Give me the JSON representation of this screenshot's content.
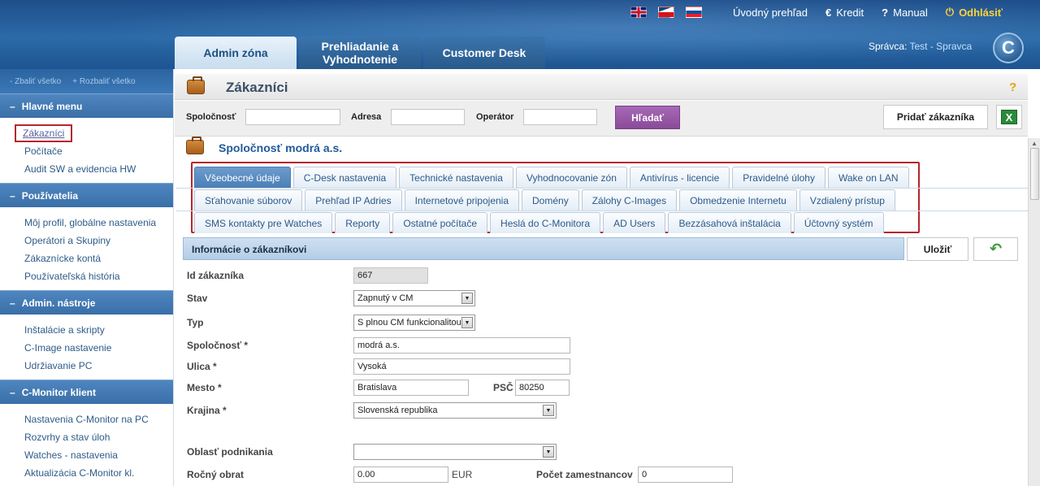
{
  "top_nav": {
    "links": [
      "Úvodný prehľad",
      "Kredit",
      "Manual",
      "Odhlásiť"
    ],
    "icons": [
      "€",
      "?",
      "⏻"
    ]
  },
  "main_tabs": [
    "Admin zóna",
    "Prehliadanie a Vyhodnotenie",
    "Customer Desk"
  ],
  "admin": {
    "label": "Správca:",
    "name": "Test - Spravca"
  },
  "sidebar": {
    "collapse_all": "- Zbaliť všetko",
    "expand_all": "+ Rozbaliť všetko",
    "sections": [
      {
        "title": "Hlavné menu",
        "items": [
          "Zákazníci",
          "Počítače",
          "Audit SW a evidencia HW"
        ]
      },
      {
        "title": "Používatelia",
        "items": [
          "Môj profil, globálne nastavenia",
          "Operátori a Skupiny",
          "Zákaznícke kontá",
          "Používateľská história"
        ]
      },
      {
        "title": "Admin. nástroje",
        "items": [
          "Inštalácie a skripty",
          "C-Image nastavenie",
          "Udržiavanie PC"
        ]
      },
      {
        "title": "C-Monitor klient",
        "items": [
          "Nastavenia C-Monitor na PC",
          "Rozvrhy a stav úloh",
          "Watches - nastavenia",
          "Aktualizácia C-Monitor kl."
        ]
      }
    ]
  },
  "page": {
    "title": "Zákazníci",
    "help": "?"
  },
  "filters": {
    "company_label": "Spoločnosť",
    "address_label": "Adresa",
    "operator_label": "Operátor",
    "search_label": "Hľadať",
    "add_label": "Pridať zákazníka"
  },
  "company": {
    "name": "Spoločnosť modrá a.s."
  },
  "sub_tabs": {
    "row1": [
      "Všeobecné údaje",
      "C-Desk nastavenia",
      "Technické nastavenia",
      "Vyhodnocovanie zón",
      "Antivírus - licencie",
      "Pravidelné úlohy",
      "Wake on LAN"
    ],
    "row2": [
      "Sťahovanie súborov",
      "Prehľad IP Adries",
      "Internetové pripojenia",
      "Domény",
      "Zálohy C-Images",
      "Obmedzenie Internetu",
      "Vzdialený prístup"
    ],
    "row3": [
      "SMS kontakty pre Watches",
      "Reporty",
      "Ostatné počítače",
      "Heslá do C-Monitora",
      "AD Users",
      "Bezzásahová inštalácia",
      "Účtovný systém"
    ]
  },
  "info": {
    "header": "Informácie o zákazníkovi",
    "save_label": "Uložiť"
  },
  "form": {
    "id_label": "Id zákazníka",
    "id_value": "667",
    "state_label": "Stav",
    "state_value": "Zapnutý v CM",
    "type_label": "Typ",
    "type_value": "S plnou CM funkcionalitou",
    "company_label": "Spoločnosť *",
    "company_value": "modrá a.s.",
    "street_label": "Ulica *",
    "street_value": "Vysoká",
    "city_label": "Mesto *",
    "city_value": "Bratislava",
    "zip_label": "PSČ *",
    "zip_value": "80250",
    "country_label": "Krajina *",
    "country_value": "Slovenská republika",
    "business_label": "Oblasť podnikania",
    "business_value": "",
    "turnover_label": "Ročný obrat",
    "turnover_value": "0.00",
    "currency": "EUR",
    "employees_label": "Počet zamestnancov",
    "employees_value": "0"
  }
}
